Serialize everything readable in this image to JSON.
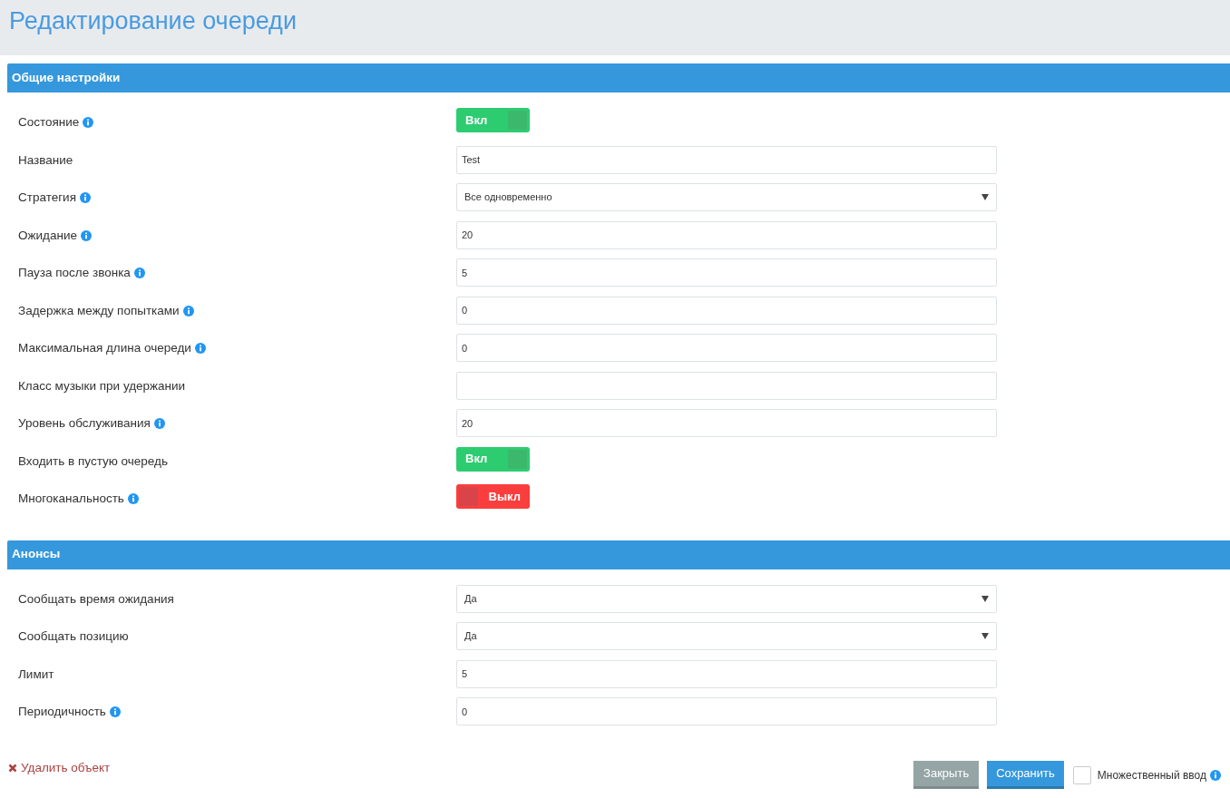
{
  "page_title": "Редактирование очереди",
  "sections": [
    {
      "title": "Общие настройки",
      "fields": [
        {
          "label": "Состояние",
          "info": true,
          "kind": "toggle",
          "on": true,
          "text": "Вкл"
        },
        {
          "label": "Название",
          "info": false,
          "kind": "text",
          "value": "Test"
        },
        {
          "label": "Стратегия",
          "info": true,
          "kind": "select",
          "value": "Все одновременно"
        },
        {
          "label": "Ожидание",
          "info": true,
          "kind": "text",
          "value": "20"
        },
        {
          "label": "Пауза после звонка",
          "info": true,
          "kind": "text",
          "value": "5"
        },
        {
          "label": "Задержка между попытками",
          "info": true,
          "kind": "text",
          "value": "0"
        },
        {
          "label": "Максимальная длина очереди",
          "info": true,
          "kind": "text",
          "value": "0"
        },
        {
          "label": "Класс музыки при удержании",
          "info": false,
          "kind": "text"
        },
        {
          "label": "Уровень обслуживания",
          "info": true,
          "kind": "text",
          "value": "20"
        },
        {
          "label": "Входить в пустую очередь",
          "info": false,
          "kind": "toggle",
          "on": true,
          "text": "Вкл"
        },
        {
          "label": "Многоканальность",
          "info": true,
          "kind": "toggle",
          "on": false,
          "text": "Выкл"
        }
      ]
    },
    {
      "title": "Анонсы",
      "fields": [
        {
          "label": "Сообщать время ожидания",
          "info": false,
          "kind": "select",
          "value": "Да"
        },
        {
          "label": "Сообщать позицию",
          "info": false,
          "kind": "select",
          "value": "Да"
        },
        {
          "label": "Лимит",
          "info": false,
          "kind": "text",
          "value": "5"
        },
        {
          "label": "Периодичность",
          "info": true,
          "kind": "text",
          "value": "0"
        }
      ]
    }
  ],
  "delete_link": "Удалить объект",
  "close_button": "Закрыть",
  "save_button": "Сохранить",
  "multi_input": {
    "label": "Множественный ввод",
    "checked": false,
    "info": true
  }
}
